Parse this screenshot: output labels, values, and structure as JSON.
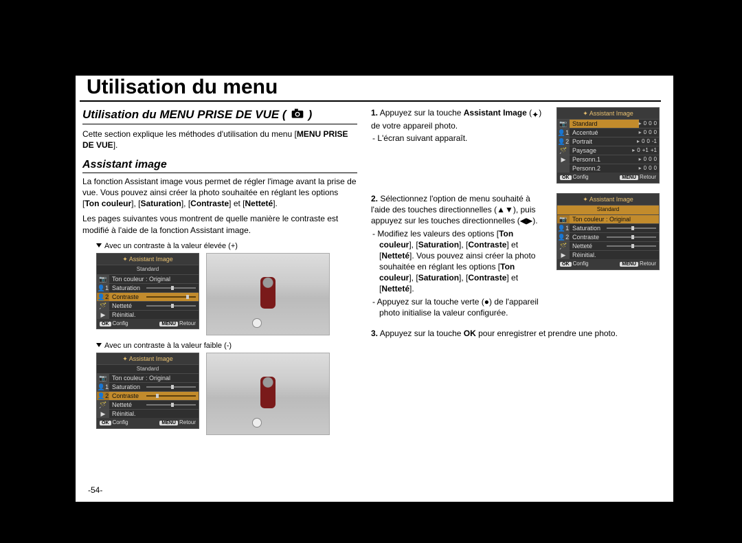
{
  "page": {
    "main_title": "Utilisation du menu",
    "page_number": "-54-"
  },
  "left": {
    "section_header": "Utilisation du MENU PRISE DE VUE (",
    "section_header_suffix": ")",
    "section_icon": "camera-icon",
    "intro_pre": "Cette section explique les méthodes d'utilisation du menu [",
    "intro_bold": "MENU PRISE DE VUE",
    "intro_post": "].",
    "subhead": "Assistant image",
    "para1_pre": "La fonction Assistant image vous permet de régler l'image avant la prise de vue. Vous pouvez ainsi créer la photo souhaitée en réglant les options [",
    "para1_b1": "Ton couleur",
    "para1_m1": "], [",
    "para1_b2": "Saturation",
    "para1_m2": "], [",
    "para1_b3": "Contraste",
    "para1_m3": "] et [",
    "para1_b4": "Netteté",
    "para1_post": "].",
    "para2": "Les pages suivantes vous montrent de quelle manière le contraste est modifié à l'aide de la fonction Assistant image.",
    "caption_high": "Avec un contraste à la valeur élevée (+)",
    "caption_low": "Avec un contraste à la valeur faible (-)"
  },
  "right": {
    "step1_num": "1.",
    "step1_pre": " Appuyez sur la touche ",
    "step1_bold": "Assistant Image",
    "step1_icon": "palette-icon",
    "step1_mid": " (",
    "step1_suffix_paren": ") de votre appareil photo.",
    "step1_bullet": "L'écran suivant apparaît.",
    "step2_num": "2.",
    "step2_text": " Sélectionnez l'option de menu souhaité à l'aide des touches directionnelles (▲▼), puis appuyez sur les touches directionnelles (◀▶).",
    "step2_bullet1_pre": "Modifiez les valeurs des options [",
    "step2_b1": "Ton couleur",
    "step2_m1": "], [",
    "step2_b2": "Saturation",
    "step2_m2": "], [",
    "step2_b3": "Contraste",
    "step2_m3": "] et [",
    "step2_b4": "Netteté",
    "step2_m4": "]. Vous pouvez ainsi créer la photo souhaitée en réglant les options [",
    "step2_b5": "Ton couleur",
    "step2_m5": "], [",
    "step2_b6": "Saturation",
    "step2_m6": "], [",
    "step2_b7": "Contraste",
    "step2_m7": "] et [",
    "step2_b8": "Netteté",
    "step2_m8": "].",
    "step2_bullet2": "Appuyez sur la touche verte (●) de l'appareil photo initialise la valeur configurée.",
    "step3_num": "3.",
    "step3_pre": " Appuyez sur la touche ",
    "step3_bold": "OK",
    "step3_post": " pour enregistrer et prendre une photo."
  },
  "lcd_preset": {
    "title": "Assistant Image",
    "rows": [
      {
        "icon": "📷",
        "label": "Standard",
        "vals": [
          "0",
          "0",
          "0"
        ],
        "hl": true
      },
      {
        "icon": "👤1",
        "label": "Accentué",
        "vals": [
          "0",
          "0",
          "0"
        ]
      },
      {
        "icon": "👤2",
        "label": "Portrait",
        "vals": [
          "0",
          "0",
          "-1"
        ]
      },
      {
        "icon": "🪄",
        "label": "Paysage",
        "vals": [
          "0",
          "+1",
          "+1"
        ]
      },
      {
        "icon": "▶",
        "label": "Personn.1",
        "vals": [
          "0",
          "0",
          "0"
        ]
      },
      {
        "icon": "",
        "label": "Personn.2",
        "vals": [
          "0",
          "0",
          "0"
        ]
      }
    ],
    "foot_ok": "OK",
    "foot_config": "Config",
    "foot_menu": "MENU",
    "foot_retour": "Retour"
  },
  "lcd_sliders": {
    "title": "Assistant Image",
    "subhead": "Standard",
    "rows": [
      {
        "icon": "📷",
        "label": "Ton couleur : Original"
      },
      {
        "icon": "👤1",
        "slider_label": "Saturation",
        "knob": 50
      },
      {
        "icon": "👤2",
        "slider_label": "Contraste",
        "knob": 50,
        "hl": false
      },
      {
        "icon": "🪄",
        "slider_label": "Netteté",
        "knob": 50
      },
      {
        "icon": "▶",
        "slider_label": "Réinitial."
      }
    ],
    "foot_ok": "OK",
    "foot_config": "Config",
    "foot_menu": "MENU",
    "foot_retour": "Retour"
  },
  "lcd_sliders_high": {
    "contrast_knob": 80
  },
  "lcd_sliders_low": {
    "contrast_knob": 20
  },
  "icons": {
    "caret_down": "▼",
    "palette": "✦"
  }
}
